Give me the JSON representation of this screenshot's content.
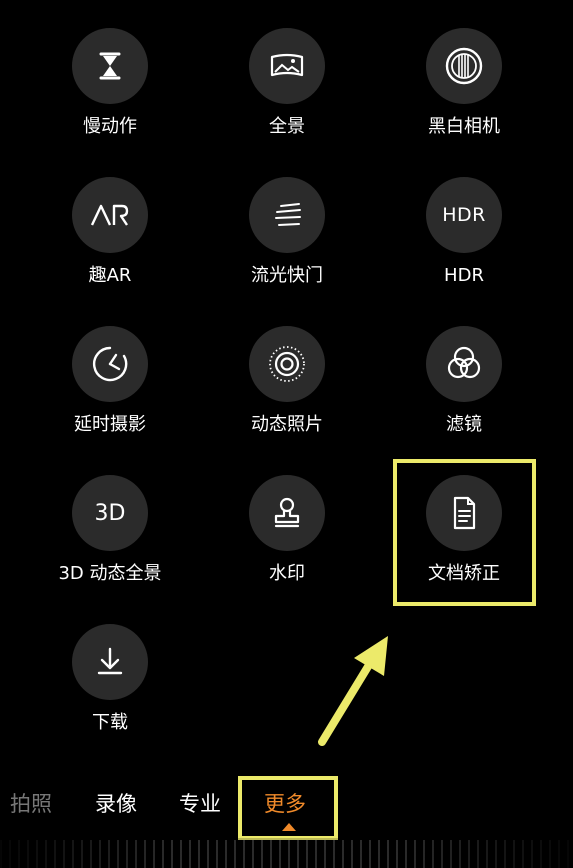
{
  "modes": [
    {
      "id": "slow-motion",
      "label": "慢动作",
      "icon": "hourglass-icon"
    },
    {
      "id": "panorama",
      "label": "全景",
      "icon": "panorama-icon"
    },
    {
      "id": "monochrome",
      "label": "黑白相机",
      "icon": "monochrome-aperture-icon"
    },
    {
      "id": "fun-ar",
      "label": "趣AR",
      "icon": "ar-icon"
    },
    {
      "id": "light-painting",
      "label": "流光快门",
      "icon": "light-streak-icon"
    },
    {
      "id": "hdr",
      "label": "HDR",
      "icon": "hdr-icon",
      "icon_text": "HDR"
    },
    {
      "id": "time-lapse",
      "label": "延时摄影",
      "icon": "timer-pie-icon"
    },
    {
      "id": "moving-picture",
      "label": "动态照片",
      "icon": "live-photo-icon"
    },
    {
      "id": "filter",
      "label": "滤镜",
      "icon": "filter-circles-icon"
    },
    {
      "id": "3d-panorama",
      "label": "3D 动态全景",
      "icon": "3d-icon",
      "icon_text": "3D"
    },
    {
      "id": "watermark",
      "label": "水印",
      "icon": "stamp-icon"
    },
    {
      "id": "document-scan",
      "label": "文档矫正",
      "icon": "document-icon"
    },
    {
      "id": "download",
      "label": "下载",
      "icon": "download-icon"
    }
  ],
  "tabs": {
    "photo": "拍照",
    "video": "录像",
    "pro": "专业",
    "more": "更多"
  },
  "colors": {
    "accent": "#f08a2a",
    "annotation": "#ecea6a",
    "icon_bg": "#2b2b2b"
  }
}
